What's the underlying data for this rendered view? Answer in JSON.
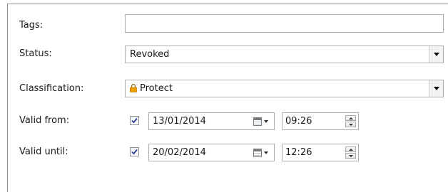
{
  "form": {
    "tags": {
      "label": "Tags:",
      "value": ""
    },
    "status": {
      "label": "Status:",
      "value": "Revoked",
      "icon": "chevron-down-icon"
    },
    "classification": {
      "label": "Classification:",
      "value": "Protect",
      "icon": "lock-icon",
      "lock_color": "#f0a000"
    },
    "valid_from": {
      "label": "Valid from:",
      "checked": true,
      "date": "13/01/2014",
      "time": "09:26"
    },
    "valid_until": {
      "label": "Valid until:",
      "checked": true,
      "date": "20/02/2014",
      "time": "12:26"
    }
  }
}
